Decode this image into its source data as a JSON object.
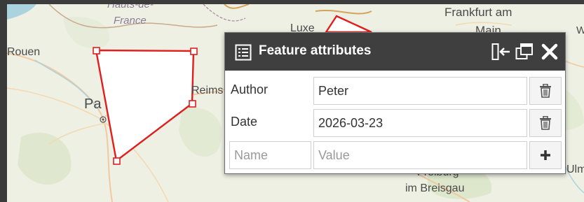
{
  "map": {
    "places": {
      "rouen": "Rouen",
      "paris": "Pa",
      "reims": "Reims",
      "frankfurt_line1": "Frankfurt am",
      "frankfurt_line2": "Main",
      "luxembourg": "Luxe",
      "region": "Hauts-de-",
      "region2": "France",
      "breisgau": "im Breisgau",
      "freiburg": "Freiburg",
      "ulm": "Ulm",
      "edge_w": "W"
    }
  },
  "popup": {
    "title": "Feature attributes",
    "icons": {
      "title": "list-icon",
      "dock": "dock-side-icon",
      "popout": "popout-window-icon",
      "close": "close-icon",
      "delete": "trash-icon",
      "add": "plus-icon"
    },
    "attributes": [
      {
        "name": "Author",
        "value": "Peter"
      },
      {
        "name": "Date",
        "value": "2026-03-23"
      }
    ],
    "new_row": {
      "name_placeholder": "Name",
      "value_placeholder": "Value"
    }
  }
}
